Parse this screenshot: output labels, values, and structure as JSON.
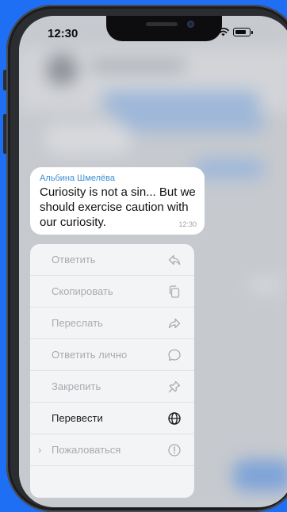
{
  "status_bar": {
    "time": "12:30"
  },
  "message": {
    "sender": "Альбина Шмелёва",
    "text": "Curiosity is not a sin... But we should exercise caution with our curiosity.",
    "time": "12:30"
  },
  "context_menu": {
    "items": [
      {
        "label": "Ответить",
        "icon": "reply-icon",
        "enabled": false
      },
      {
        "label": "Скопировать",
        "icon": "copy-icon",
        "enabled": false
      },
      {
        "label": "Переслать",
        "icon": "forward-icon",
        "enabled": false
      },
      {
        "label": "Ответить лично",
        "icon": "chat-bubble-icon",
        "enabled": false
      },
      {
        "label": "Закрепить",
        "icon": "pin-icon",
        "enabled": false
      },
      {
        "label": "Перевести",
        "icon": "globe-icon",
        "enabled": true
      },
      {
        "label": "Пожаловаться",
        "icon": "alert-icon",
        "enabled": false
      }
    ]
  },
  "colors": {
    "background": "#1f6ff5",
    "sender_name": "#3b8ed4",
    "menu_disabled_text": "#a7acb1",
    "menu_active_text": "#1c1c1e"
  }
}
